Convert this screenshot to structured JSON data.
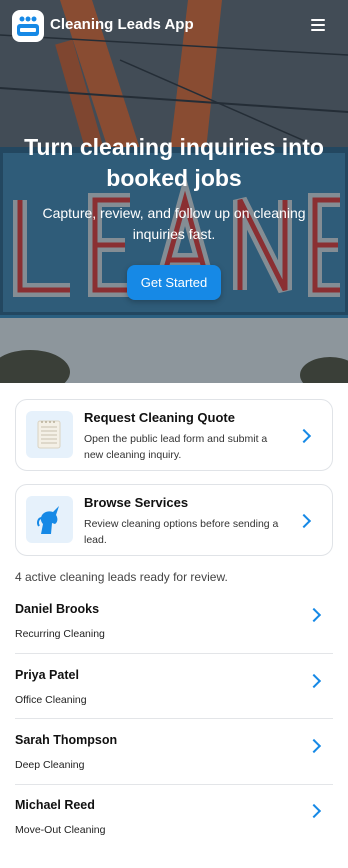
{
  "app": {
    "title": "Cleaning Leads App",
    "logo_icon": "cleaning-appliance-icon",
    "menu_icon": "hamburger-menu-icon"
  },
  "hero": {
    "title": "Turn cleaning inquiries into booked jobs",
    "subtitle": "Capture, review, and follow up on cleaning inquiries fast.",
    "cta_label": "Get Started",
    "background": "neon-sign-photo"
  },
  "cards": [
    {
      "title": "Request Cleaning Quote",
      "description": "Open the public lead form and submit a new cleaning inquiry.",
      "icon": "notepad-icon"
    },
    {
      "title": "Browse Services",
      "description": "Review cleaning options before sending a lead.",
      "icon": "unicorn-icon"
    }
  ],
  "summary": "4 active cleaning leads ready for review.",
  "leads": [
    {
      "name": "Daniel Brooks",
      "service": "Recurring Cleaning"
    },
    {
      "name": "Priya Patel",
      "service": "Office Cleaning"
    },
    {
      "name": "Sarah Thompson",
      "service": "Deep Cleaning"
    },
    {
      "name": "Michael Reed",
      "service": "Move-Out Cleaning"
    }
  ],
  "colors": {
    "accent": "#1689e6",
    "card_thumb_bg": "#e6f1fb",
    "divider": "#e3e5e8"
  }
}
